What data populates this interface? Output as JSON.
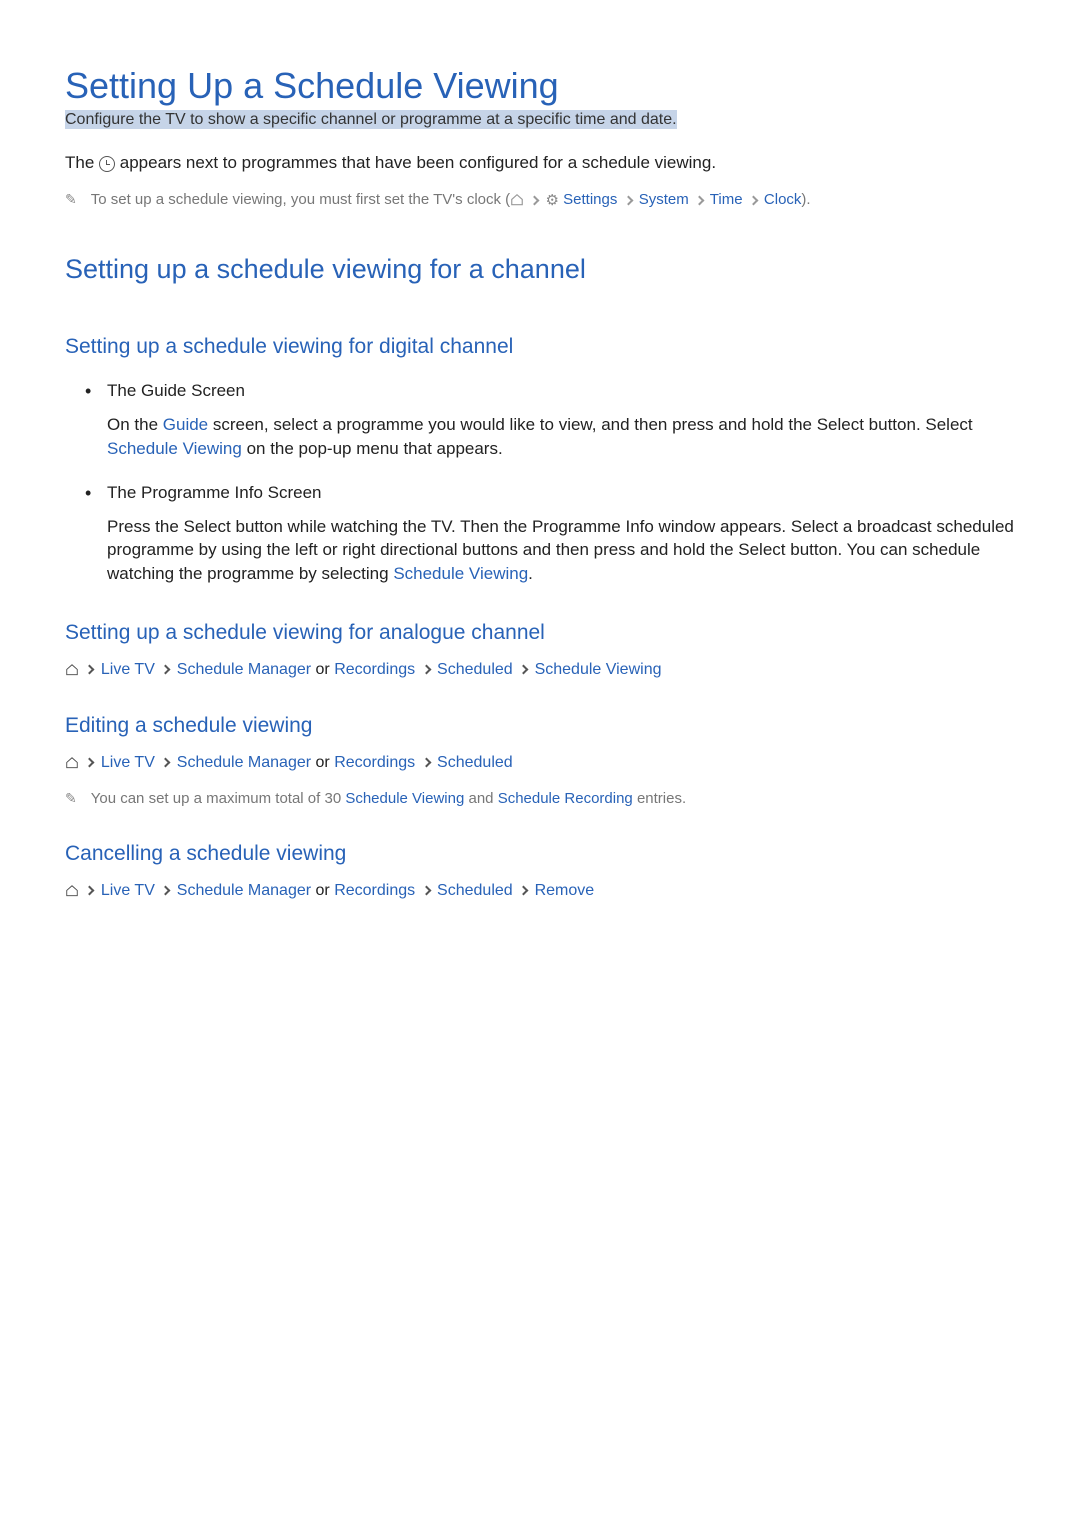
{
  "title": "Setting Up a Schedule Viewing",
  "subtitle": "Configure the TV to show a specific channel or programme at a specific time and date.",
  "intro": {
    "prefix": "The ",
    "suffix": " appears next to programmes that have been configured for a schedule viewing."
  },
  "clockNote": {
    "prefix": "To set up a schedule viewing, you must first set the TV's clock (",
    "settings": "Settings",
    "system": "System",
    "time": "Time",
    "clock": "Clock",
    "suffix": ")."
  },
  "h2": "Setting up a schedule viewing for a channel",
  "digitalSection": {
    "heading": "Setting up a schedule viewing for digital channel",
    "guide": {
      "title": "The Guide Screen",
      "prefix": "On the ",
      "link1": "Guide",
      "mid": " screen, select a programme you would like to view, and then press and hold the Select button. Select ",
      "link2": "Schedule Viewing",
      "suffix": " on the pop-up menu that appears."
    },
    "programme": {
      "title": "The Programme Info Screen",
      "prefix": "Press the Select button while watching the TV. Then the Programme Info window appears. Select a broadcast scheduled programme by using the left or right directional buttons and then press and hold the Select button. You can schedule watching the programme by selecting ",
      "link": "Schedule Viewing",
      "suffix": "."
    }
  },
  "analogueSection": {
    "heading": "Setting up a schedule viewing for analogue channel",
    "breadcrumb": {
      "liveTV": "Live TV",
      "scheduleManager": "Schedule Manager",
      "or": " or ",
      "recordings": "Recordings",
      "scheduled": "Scheduled",
      "scheduleViewing": "Schedule Viewing"
    }
  },
  "editingSection": {
    "heading": "Editing a schedule viewing",
    "breadcrumb": {
      "liveTV": "Live TV",
      "scheduleManager": "Schedule Manager",
      "or": " or ",
      "recordings": "Recordings",
      "scheduled": "Scheduled"
    },
    "note": {
      "prefix": "You can set up a maximum total of 30 ",
      "link1": "Schedule Viewing",
      "mid": " and ",
      "link2": "Schedule Recording",
      "suffix": " entries."
    }
  },
  "cancellingSection": {
    "heading": "Cancelling a schedule viewing",
    "breadcrumb": {
      "liveTV": "Live TV",
      "scheduleManager": "Schedule Manager",
      "or": " or ",
      "recordings": "Recordings",
      "scheduled": "Scheduled",
      "remove": "Remove"
    }
  }
}
